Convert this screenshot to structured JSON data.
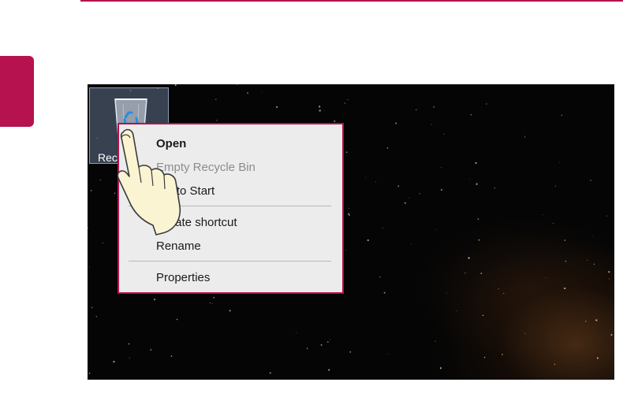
{
  "colors": {
    "accent": "#b5124f",
    "desktop_background": "#050505",
    "menu_background": "#ececec",
    "menu_text": "#1a1a1a",
    "menu_disabled_text": "#8c8c8c"
  },
  "desktop": {
    "icon": {
      "icon_name": "recycle-bin-icon",
      "label": "Recycle Bin"
    }
  },
  "context_menu": {
    "items": [
      {
        "label": "Open",
        "style": "bold"
      },
      {
        "label": "Empty Recycle Bin",
        "style": "disabled"
      },
      {
        "label": "Pin to Start",
        "style": "normal"
      },
      {
        "label": "Create shortcut",
        "style": "normal"
      },
      {
        "label": "Rename",
        "style": "normal"
      },
      {
        "label": "Properties",
        "style": "normal"
      }
    ]
  },
  "pointer": {
    "icon_name": "pointing-hand-icon"
  }
}
